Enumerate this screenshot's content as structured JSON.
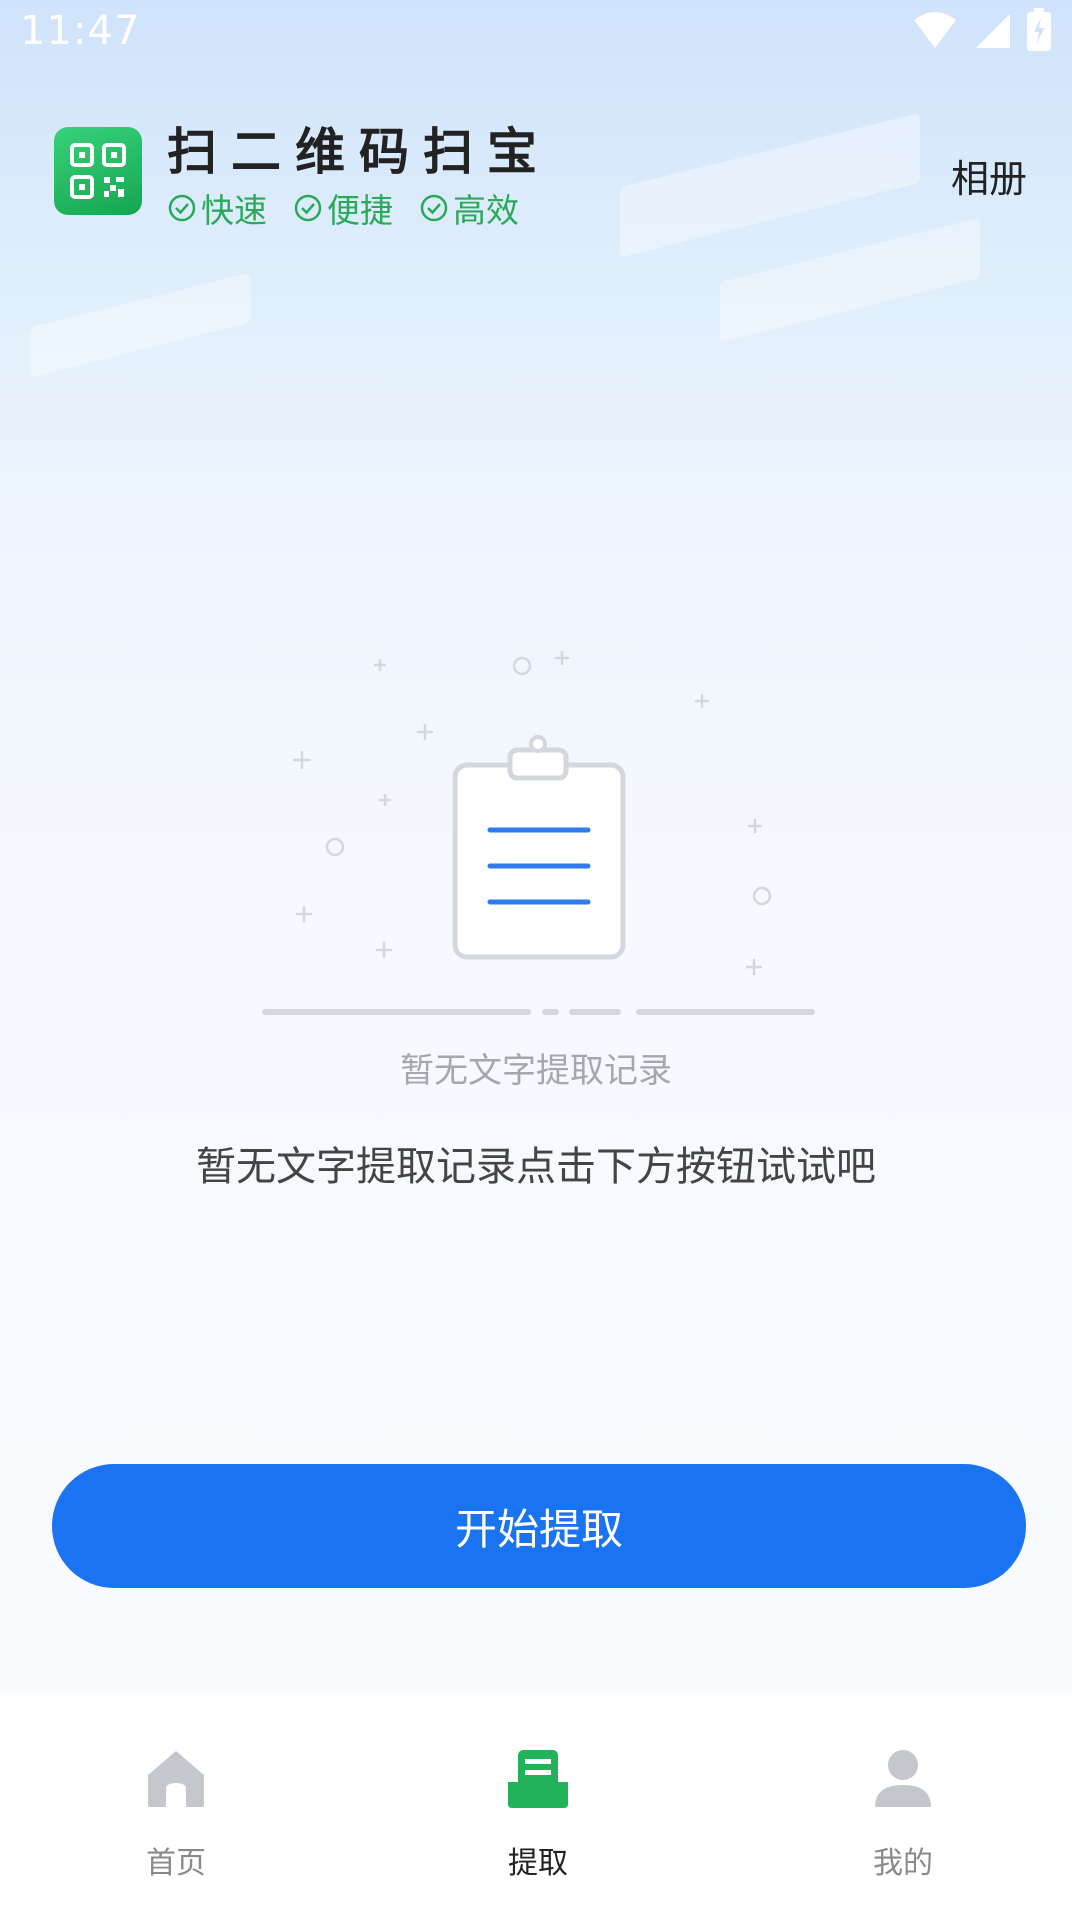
{
  "status_bar": {
    "time": "11:47"
  },
  "header": {
    "title": "扫二维码扫宝",
    "tags": [
      "快速",
      "便捷",
      "高效"
    ],
    "album_label": "相册"
  },
  "empty_state": {
    "caption": "暂无文字提取记录",
    "hint": "暂无文字提取记录点击下方按钮试试吧"
  },
  "primary_button": {
    "label": "开始提取"
  },
  "bottom_nav": [
    {
      "label": "首页",
      "icon": "home-icon",
      "active": false
    },
    {
      "label": "提取",
      "icon": "extract-icon",
      "active": true
    },
    {
      "label": "我的",
      "icon": "profile-icon",
      "active": false
    }
  ],
  "colors": {
    "accent": "#1a73f0",
    "brand_green": "#2aaa59",
    "active_nav": "#22b25a"
  }
}
